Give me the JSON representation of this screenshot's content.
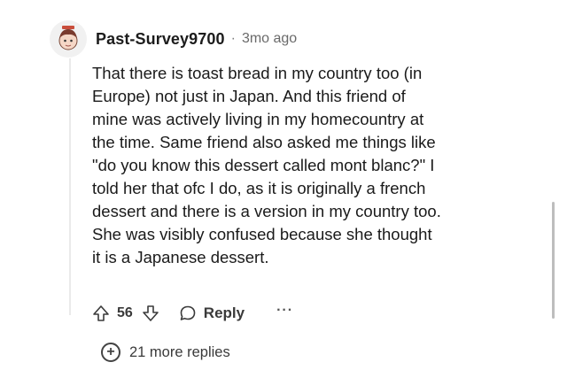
{
  "comment": {
    "username": "Past-Survey9700",
    "separator": "·",
    "time": "3mo ago",
    "lines": [
      "That there is toast bread in my country too (in",
      "Europe) not just in Japan. And this friend of",
      "mine was actively living in my homecountry at",
      "the time. Same friend also asked me things like",
      "\"do you know this dessert called mont blanc?\" I",
      "told her that ofc I do, as it is originally a french",
      "dessert and there is a version in my country too.",
      "She was visibly confused because she thought",
      "it is a Japanese dessert."
    ]
  },
  "actions": {
    "score": "56",
    "reply_label": "Reply",
    "more_label": "···"
  },
  "more_replies": {
    "icon": "+",
    "label": "21 more replies"
  },
  "icons": {
    "avatar": "avatar-icon",
    "upvote": "upvote-arrow-icon",
    "downvote": "downvote-arrow-icon",
    "reply": "speech-bubble-icon",
    "expand": "plus-circle-icon"
  },
  "colors": {
    "text": "#1c1c1c",
    "muted": "#6a6a6a",
    "background": "#ffffff"
  }
}
